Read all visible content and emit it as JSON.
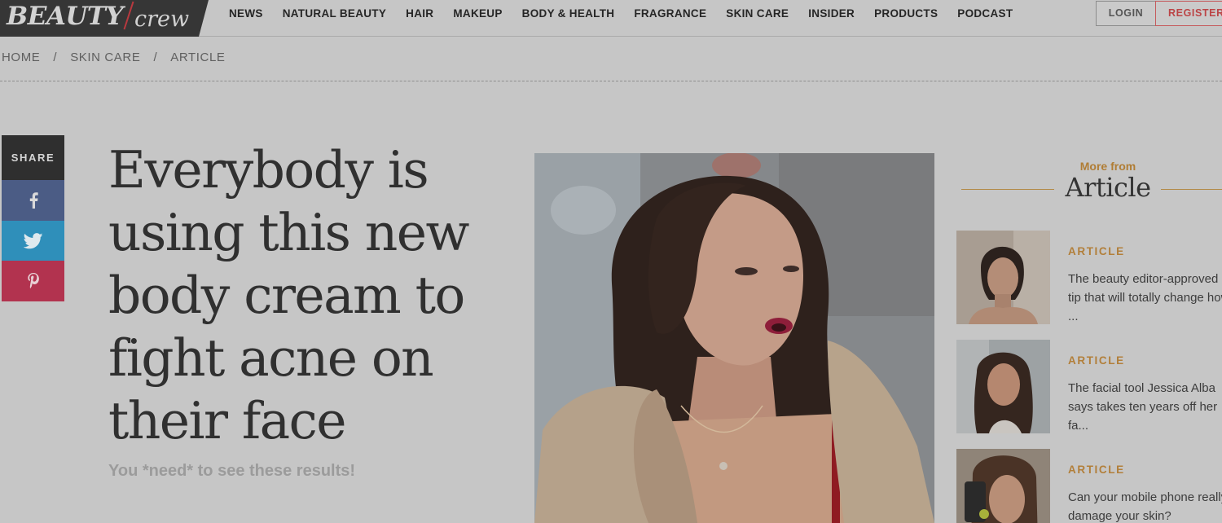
{
  "header": {
    "logo_primary": "BEAUTY",
    "logo_secondary": "crew",
    "nav": [
      "NEWS",
      "NATURAL BEAUTY",
      "HAIR",
      "MAKEUP",
      "BODY & HEALTH",
      "FRAGRANCE",
      "SKIN CARE",
      "INSIDER",
      "PRODUCTS",
      "PODCAST"
    ],
    "login_label": "LOGIN",
    "register_label": "REGISTER"
  },
  "breadcrumb": {
    "items": [
      "HOME",
      "SKIN CARE",
      "ARTICLE"
    ],
    "separator": "/"
  },
  "share": {
    "label": "SHARE",
    "icons": [
      "facebook-icon",
      "twitter-icon",
      "pinterest-icon"
    ]
  },
  "article": {
    "title": "Everybody is using this new body cream to fight acne on their face",
    "subtitle": "You *need* to see these results!"
  },
  "sidebar": {
    "heading_small": "More from",
    "heading_large": "Article",
    "cards": [
      {
        "category": "ARTICLE",
        "title": "The beauty editor-approved tip that will totally change how ..."
      },
      {
        "category": "ARTICLE",
        "title": "The facial tool Jessica Alba says takes ten years off her fa..."
      },
      {
        "category": "ARTICLE",
        "title": "Can your mobile phone really damage your skin?"
      }
    ]
  },
  "colors": {
    "overlay_bg": "#c6c6c6",
    "logo_bg": "#363636",
    "accent_gold": "#b27f3a",
    "register_red": "#bb4446",
    "facebook": "#4b5c85",
    "twitter": "#2f8fba",
    "pinterest": "#b2334f"
  }
}
